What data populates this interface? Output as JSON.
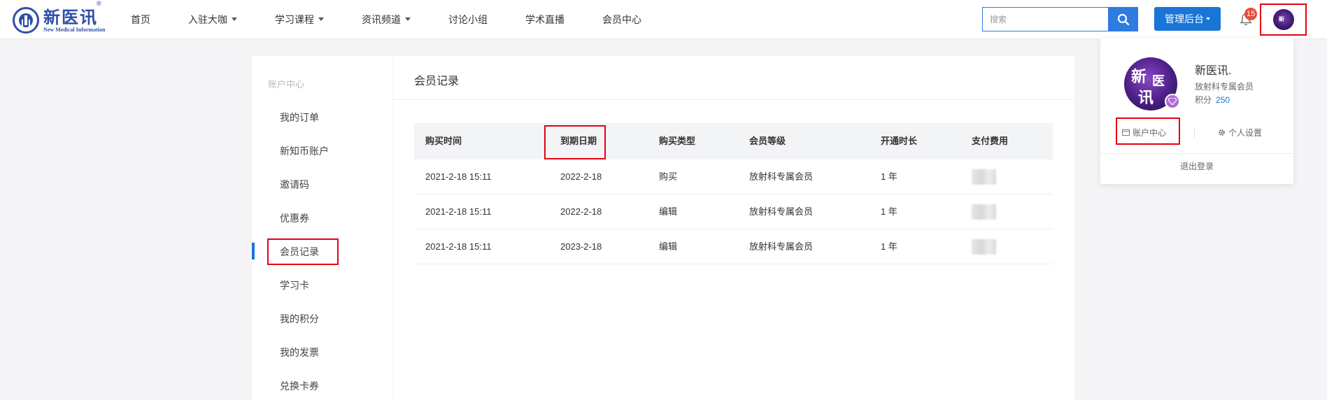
{
  "header": {
    "logo": {
      "cn": "新医讯",
      "en": "New Medical Information",
      "mark": "®"
    },
    "nav": [
      {
        "label": "首页",
        "dropdown": false
      },
      {
        "label": "入驻大咖",
        "dropdown": true
      },
      {
        "label": "学习课程",
        "dropdown": true
      },
      {
        "label": "资讯频道",
        "dropdown": true
      },
      {
        "label": "讨论小组",
        "dropdown": false
      },
      {
        "label": "学术直播",
        "dropdown": false
      },
      {
        "label": "会员中心",
        "dropdown": false
      }
    ],
    "search": {
      "placeholder": "搜索",
      "value": ""
    },
    "admin_button": "管理后台",
    "notification_count": "15",
    "search_icon": "search-icon",
    "bell_icon": "bell-icon"
  },
  "sidebar": {
    "title": "账户中心",
    "items": [
      {
        "label": "我的订单"
      },
      {
        "label": "新知币账户"
      },
      {
        "label": "邀请码"
      },
      {
        "label": "优惠券"
      },
      {
        "label": "会员记录",
        "active": true
      },
      {
        "label": "学习卡"
      },
      {
        "label": "我的积分"
      },
      {
        "label": "我的发票"
      },
      {
        "label": "兑换卡券"
      }
    ]
  },
  "main": {
    "title": "会员记录",
    "table": {
      "headers": [
        "购买时间",
        "到期日期",
        "购买类型",
        "会员等级",
        "开通时长",
        "支付费用"
      ],
      "rows": [
        [
          "2021-2-18 15:11",
          "2022-2-18",
          "购买",
          "放射科专属会员",
          "1 年"
        ],
        [
          "2021-2-18 15:11",
          "2022-2-18",
          "编辑",
          "放射科专属会员",
          "1 年"
        ],
        [
          "2021-2-18 15:11",
          "2023-2-18",
          "编辑",
          "放射科专属会员",
          "1 年"
        ]
      ]
    }
  },
  "dropdown": {
    "avatar_text": [
      "新",
      "医",
      "讯"
    ],
    "name": "新医讯.",
    "subtitle": "放射科专属会员",
    "points_label": "积分",
    "points_value": "250",
    "account_center": "账户中心",
    "personal_settings": "个人设置",
    "logout": "退出登录"
  },
  "colors": {
    "primary": "#1975d6",
    "highlight": "#e60012",
    "badge": "#e74c3c",
    "brand": "#2f4fa8"
  }
}
